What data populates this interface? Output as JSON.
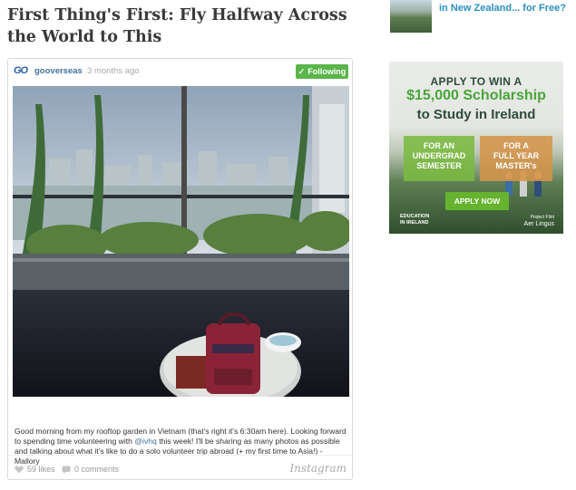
{
  "article": {
    "title": "First Thing's First: Fly Halfway Across the World to This"
  },
  "sidebar": {
    "related_link": "in New Zealand... for Free?"
  },
  "post": {
    "logo_text": "GO",
    "username": "gooverseas",
    "separator": "·",
    "time_ago": "3 months ago",
    "follow_icon": "✓",
    "follow_label": "Following",
    "caption_part1": "Good morning from my rooftop garden in Vietnam (that's right it's 6:30am here). Looking forward to spending time volunteering with ",
    "caption_mention": "@ivhq",
    "caption_part2": " this week! I'll be sharing as many photos as possible and talking about what it's like to do a solo volunteer trip abroad (+ my first time to Asia!) - Mallory",
    "likes": "59 likes",
    "comments": "0 comments",
    "brand": "Instagram",
    "icons": {
      "likes": "heart-icon",
      "comments": "comment-icon",
      "follow": "check-icon"
    }
  },
  "ad": {
    "line1": "APPLY TO WIN A",
    "line2": "$15,000 Scholarship",
    "line3": "to Study in Ireland",
    "box1_l1": "FOR AN",
    "box1_l2": "UNDERGRAD",
    "box1_l3": "SEMESTER",
    "box2_l1": "FOR A",
    "box2_l2": "FULL YEAR",
    "box2_l3": "MASTER's",
    "button": "APPLY NOW",
    "logo1_l1": "EDUCATION",
    "logo1_l2": "IN IRELAND",
    "logo2_l1": "Project Flint",
    "logo2_l2": "Aer Lingus",
    "accent_green": "#65b32e",
    "accent_orange": "#d4944a"
  }
}
